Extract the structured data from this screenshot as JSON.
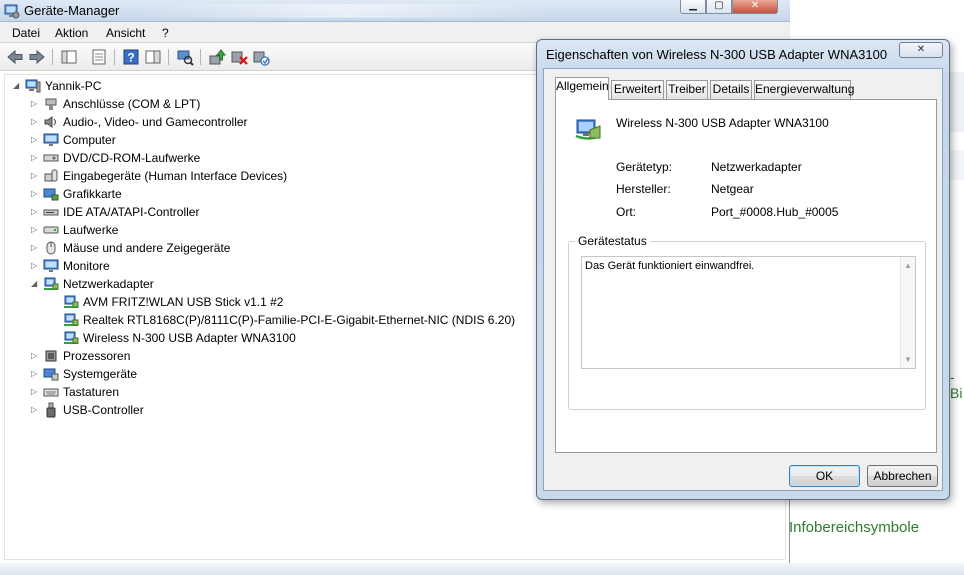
{
  "colors": {
    "accent_text": "#2d7d2d",
    "dialog_frame": "#c5d6ea",
    "titlebar": "#c6d6ea",
    "close_red": "#c9513e"
  },
  "background": {
    "green_text": "Infobereichsymbole",
    "partial_text": "-Bi"
  },
  "device_manager": {
    "title": "Geräte-Manager",
    "menu": [
      "Datei",
      "Aktion",
      "Ansicht",
      "?"
    ],
    "toolbar_icons": [
      "back-arrow-icon",
      "forward-arrow-icon",
      "console-tree-icon",
      "properties-icon",
      "help-icon",
      "action-pane-icon",
      "scan-hardware-icon",
      "update-driver-icon",
      "uninstall-icon",
      "enable-device-icon"
    ],
    "tree": [
      {
        "label": "Yannik-PC",
        "level": 0,
        "expanded": true,
        "icon": "computer-icon"
      },
      {
        "label": "Anschlüsse (COM & LPT)",
        "level": 1,
        "expanded": false,
        "icon": "port-icon"
      },
      {
        "label": "Audio-, Video- und Gamecontroller",
        "level": 1,
        "expanded": false,
        "icon": "speaker-icon"
      },
      {
        "label": "Computer",
        "level": 1,
        "expanded": false,
        "icon": "monitor-icon"
      },
      {
        "label": "DVD/CD-ROM-Laufwerke",
        "level": 1,
        "expanded": false,
        "icon": "disc-drive-icon"
      },
      {
        "label": "Eingabegeräte (Human Interface Devices)",
        "level": 1,
        "expanded": false,
        "icon": "hid-icon"
      },
      {
        "label": "Grafikkarte",
        "level": 1,
        "expanded": false,
        "icon": "display-adapter-icon"
      },
      {
        "label": "IDE ATA/ATAPI-Controller",
        "level": 1,
        "expanded": false,
        "icon": "ide-controller-icon"
      },
      {
        "label": "Laufwerke",
        "level": 1,
        "expanded": false,
        "icon": "disk-drive-icon"
      },
      {
        "label": "Mäuse und andere Zeigegeräte",
        "level": 1,
        "expanded": false,
        "icon": "mouse-icon"
      },
      {
        "label": "Monitore",
        "level": 1,
        "expanded": false,
        "icon": "monitor-icon"
      },
      {
        "label": "Netzwerkadapter",
        "level": 1,
        "expanded": true,
        "icon": "network-adapter-icon"
      },
      {
        "label": "AVM FRITZ!WLAN USB Stick v1.1 #2",
        "level": 2,
        "icon": "network-adapter-icon"
      },
      {
        "label": "Realtek RTL8168C(P)/8111C(P)-Familie-PCI-E-Gigabit-Ethernet-NIC (NDIS 6.20)",
        "level": 2,
        "icon": "network-adapter-icon"
      },
      {
        "label": "Wireless N-300 USB Adapter WNA3100",
        "level": 2,
        "icon": "network-adapter-icon"
      },
      {
        "label": "Prozessoren",
        "level": 1,
        "expanded": false,
        "icon": "processor-icon"
      },
      {
        "label": "Systemgeräte",
        "level": 1,
        "expanded": false,
        "icon": "system-device-icon"
      },
      {
        "label": "Tastaturen",
        "level": 1,
        "expanded": false,
        "icon": "keyboard-icon"
      },
      {
        "label": "USB-Controller",
        "level": 1,
        "expanded": false,
        "icon": "usb-icon"
      }
    ]
  },
  "dialog": {
    "title": "Eigenschaften von Wireless N-300 USB Adapter WNA3100",
    "close_glyph": "✕",
    "tabs": [
      "Allgemein",
      "Erweitert",
      "Treiber",
      "Details",
      "Energieverwaltung"
    ],
    "active_tab": 0,
    "device_name": "Wireless N-300 USB Adapter WNA3100",
    "properties": [
      {
        "label": "Gerätetyp:",
        "value": "Netzwerkadapter"
      },
      {
        "label": "Hersteller:",
        "value": "Netgear"
      },
      {
        "label": "Ort:",
        "value": "Port_#0008.Hub_#0005"
      }
    ],
    "status_group_label": "Gerätestatus",
    "status_text": "Das Gerät funktioniert einwandfrei.",
    "ok_label": "OK",
    "cancel_label": "Abbrechen"
  }
}
